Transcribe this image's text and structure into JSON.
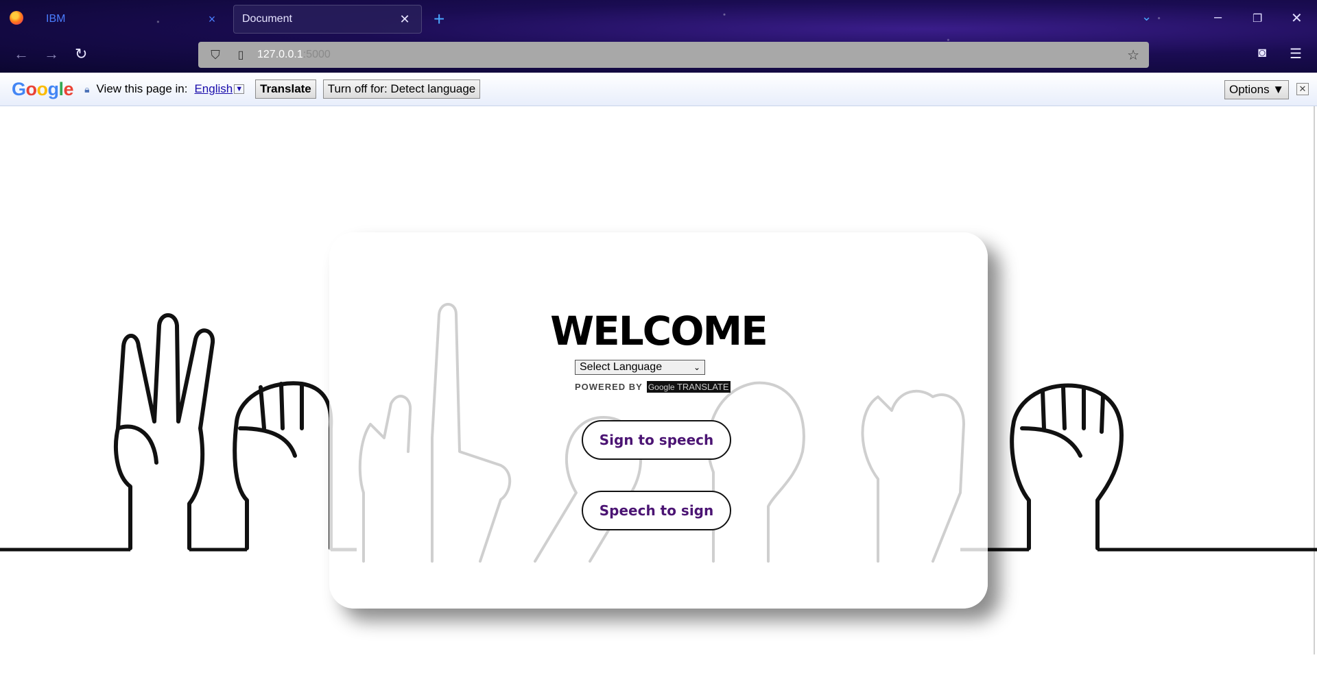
{
  "browser": {
    "tabs": [
      {
        "label": "IBM",
        "close": "×"
      },
      {
        "label": "Document",
        "close": "✕"
      }
    ],
    "url_host": "127.0.0.1",
    "url_port": ":5000"
  },
  "translate_bar": {
    "view_text": "View this page in:",
    "language": "English",
    "translate_button": "Translate",
    "turn_off_button": "Turn off for: Detect language",
    "options_button": "Options ▼"
  },
  "main": {
    "title": "WELCOME",
    "language_select": "Select Language",
    "powered_by": "POWERED BY",
    "google_word": "Google",
    "translate_word": "TRANSLATE",
    "buttons": {
      "sign_to_speech": "Sign to speech",
      "speech_to_sign": "Speech to sign"
    }
  },
  "colors": {
    "button_text": "#4b1473",
    "translate_bar_bg": "#e8eefb"
  }
}
